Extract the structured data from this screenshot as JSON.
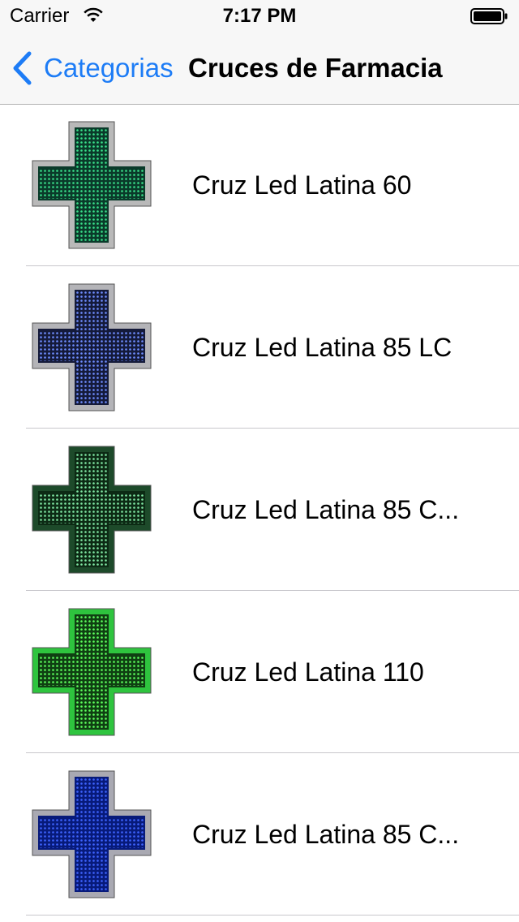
{
  "status_bar": {
    "carrier": "Carrier",
    "time": "7:17 PM"
  },
  "nav": {
    "back_label": "Categorias",
    "title": "Cruces de Farmacia"
  },
  "products": [
    {
      "name": "Cruz Led Latina 60",
      "frame": "#b9b9b9",
      "face": "#0a3a2a",
      "led": "#39e08a"
    },
    {
      "name": "Cruz Led Latina 85 LC",
      "frame": "#b4b4b8",
      "face": "#141a3a",
      "led": "#6f8dff"
    },
    {
      "name": "Cruz Led Latina 85 C...",
      "frame": "#1d4a2a",
      "face": "#0c2a14",
      "led": "#7fe6a2"
    },
    {
      "name": "Cruz Led Latina 110",
      "frame": "#2ec43e",
      "face": "#0f3f12",
      "led": "#5dff5d"
    },
    {
      "name": "Cruz Led Latina 85 C...",
      "frame": "#a9a9b2",
      "face": "#071a7a",
      "led": "#3e63ff"
    }
  ],
  "colors": {
    "accent": "#1d7cf6",
    "separator": "#c8c7cc",
    "bar_bg": "#f7f7f7"
  },
  "icons": {
    "wifi": "wifi-icon",
    "battery": "battery-icon",
    "back": "chevron-left-icon"
  }
}
